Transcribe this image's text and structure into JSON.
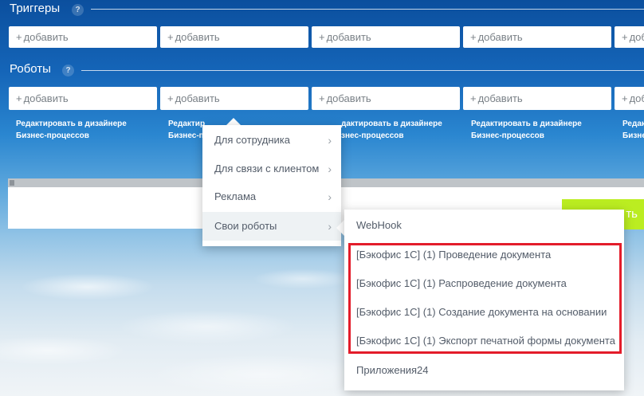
{
  "triggers": {
    "title": "Триггеры",
    "help": "?",
    "add_labels": [
      "добавить",
      "добавить",
      "добавить",
      "добавить",
      "добав"
    ]
  },
  "robots": {
    "title": "Роботы",
    "help": "?",
    "add_labels": [
      "добавить",
      "добавить",
      "добавить",
      "добавить",
      "добав"
    ],
    "edit_links": [
      [
        "Редактировать в дизайнере",
        "Бизнес-процессов"
      ],
      [
        "Редактир",
        "Бизнес-п"
      ],
      [
        "дактировать в дизайнере",
        "знес-процессов"
      ],
      [
        "Редактировать в дизайнере",
        "Бизнес-процессов"
      ],
      [
        "Редак",
        "Бизне"
      ]
    ]
  },
  "plus_glyph": "+",
  "green_button_label": "ть",
  "menu": {
    "items": [
      {
        "label": "Для сотрудника",
        "chevron": "›"
      },
      {
        "label": "Для связи с клиентом",
        "chevron": "›"
      },
      {
        "label": "Реклама",
        "chevron": "›"
      },
      {
        "label": "Свои роботы",
        "chevron": "›"
      }
    ]
  },
  "submenu": {
    "items": [
      "WebHook",
      "[Бэкофис 1С] (1) Проведение документа",
      "[Бэкофис 1С] (1) Распроведение документа",
      "[Бэкофис 1С] (1) Создание документа на основании",
      "[Бэкофис 1С] (1) Экспорт печатной формы документа",
      "Приложения24"
    ]
  },
  "colors": {
    "highlight": "#e31c2a",
    "accent_button": "#bbed21"
  }
}
